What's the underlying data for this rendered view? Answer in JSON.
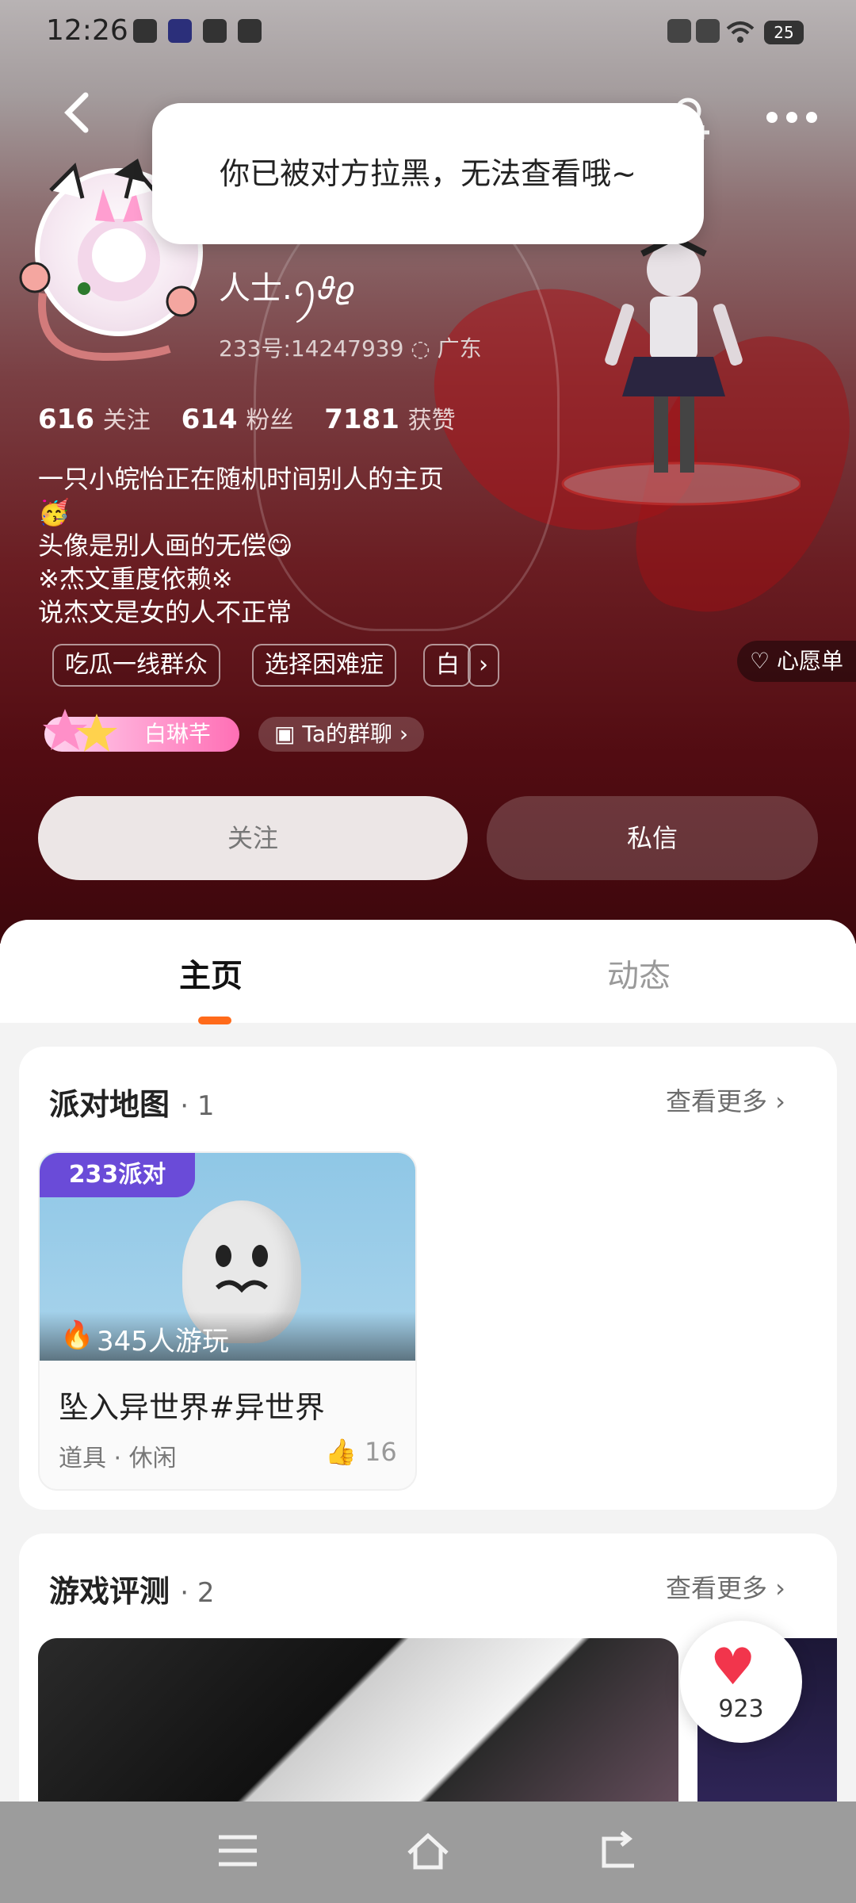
{
  "status_bar": {
    "time": "12:26",
    "battery": "25"
  },
  "toast": {
    "text": "你已被对方拉黑，无法查看哦~"
  },
  "profile": {
    "nickname": "人士.ꪆ𝜗𝜚",
    "id_location": "233号:14247939 ◌ 广东",
    "stats": {
      "following_count": "616",
      "following_label": "关注",
      "fans_count": "614",
      "fans_label": "粉丝",
      "likes_count": "7181",
      "likes_label": "获赞"
    },
    "bio_lines": [
      "一只小皖怡正在随机时间别人的主页",
      "🥳",
      "头像是别人画的无偿😋",
      "※杰文重度依赖※",
      "说杰文是女的人不正常"
    ],
    "tags": [
      "吃瓜一线群众",
      "选择困难症",
      "白"
    ],
    "tag_more": "›",
    "wishlist_label": "♡ 心愿单",
    "badge_name": "白琳芊",
    "group_chat_label": "Ta的群聊 ›",
    "follow_label": "关注",
    "message_label": "私信"
  },
  "tabs": {
    "home": "主页",
    "moments": "动态"
  },
  "party_maps": {
    "title": "派对地图",
    "count": "· 1",
    "more": "查看更多 ›",
    "item": {
      "logo": "233派对",
      "plays": "345人游玩",
      "name": "坠入异世界#异世界",
      "category": "道具 · 休闲",
      "likes": "16"
    }
  },
  "game_reviews": {
    "title": "游戏评测",
    "count": "· 2",
    "more": "查看更多 ›"
  },
  "floating_like": {
    "count": "923"
  },
  "icons": [
    "back-icon",
    "add-user-icon",
    "more-icon",
    "heart-icon",
    "thumb-up-icon",
    "flame-icon",
    "menu-icon",
    "home-icon",
    "return-icon"
  ]
}
